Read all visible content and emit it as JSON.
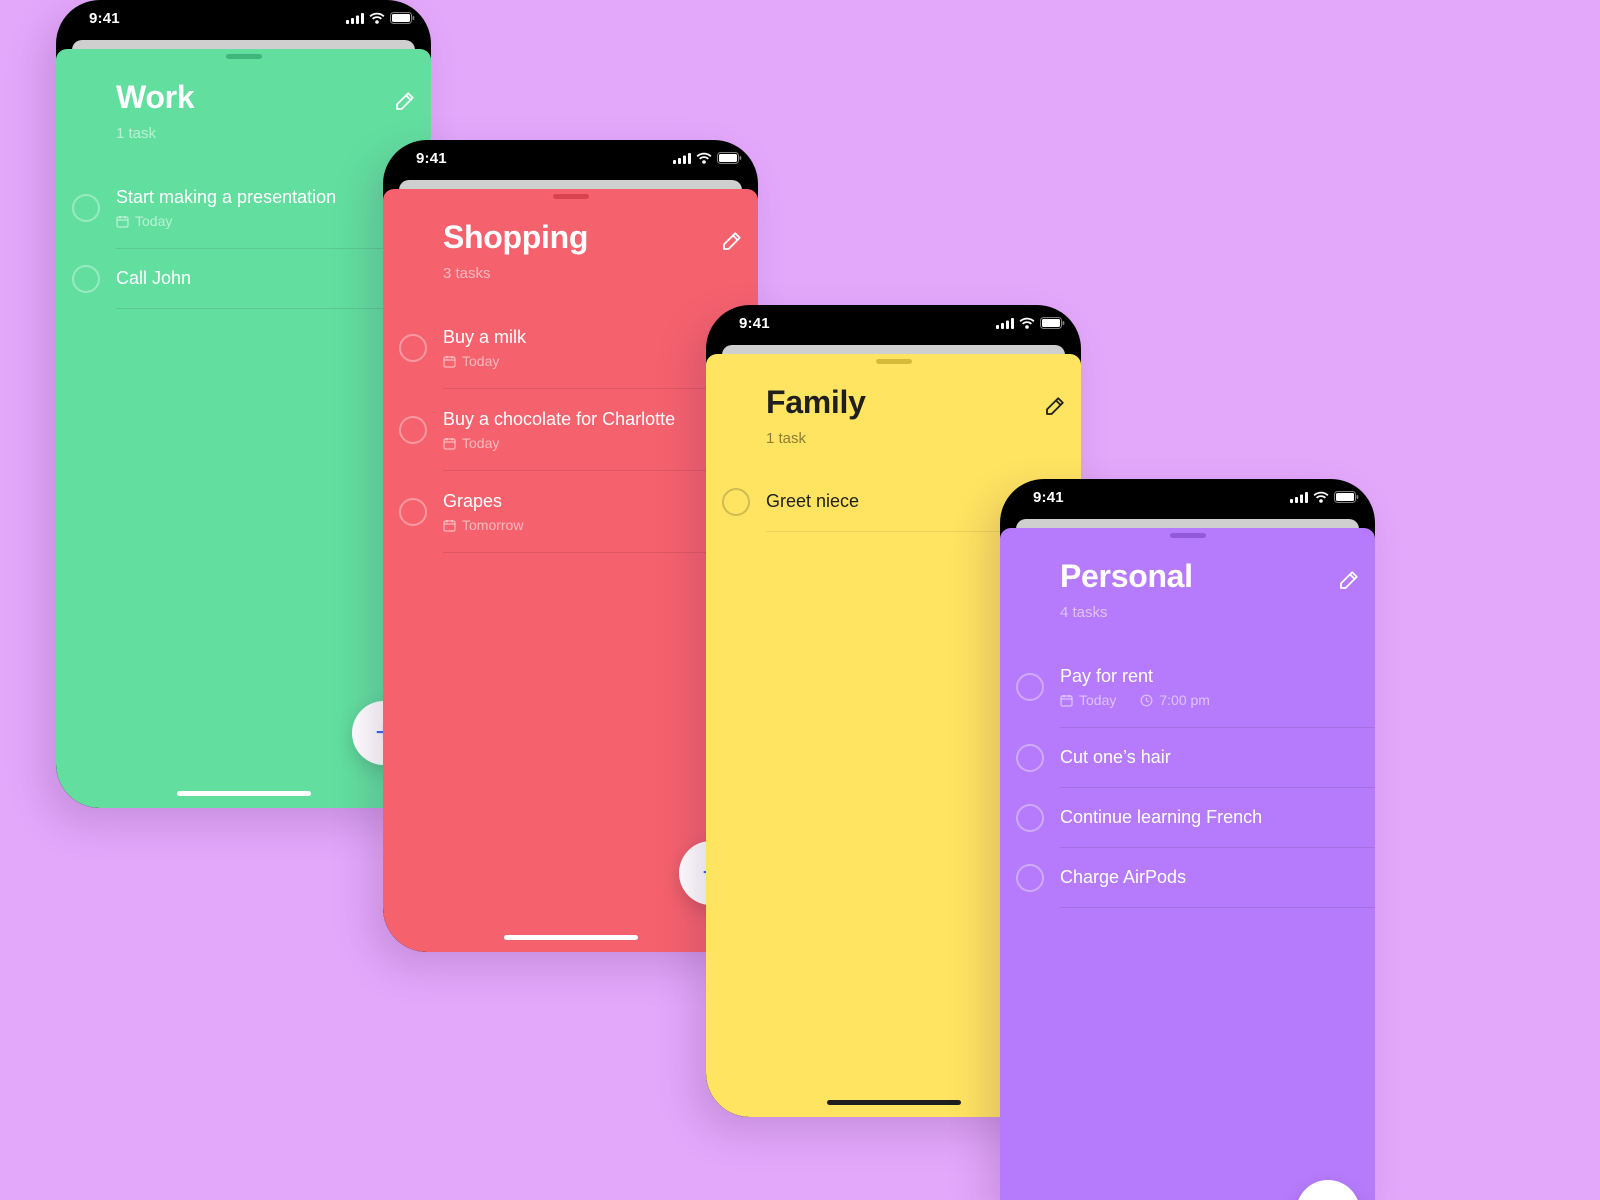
{
  "theme": {
    "background": "#e3a8fa",
    "work": "#62df9f",
    "shopping": "#f5626e",
    "family": "#fee461",
    "personal": "#b67bfd",
    "fab_plus": "#2f6bff"
  },
  "status": {
    "time": "9:41"
  },
  "icons": {
    "edit": "pencil-icon",
    "date": "calendar-icon",
    "time": "clock-icon",
    "add": "plus-icon",
    "signal": "cellular-signal-icon",
    "wifi": "wifi-icon",
    "battery": "battery-icon"
  },
  "fab": {
    "label": "+"
  },
  "lists": {
    "work": {
      "title": "Work",
      "count": "1 task",
      "tasks": [
        {
          "title": "Start making a presentation",
          "date": "Today"
        },
        {
          "title": "Call John"
        }
      ]
    },
    "shopping": {
      "title": "Shopping",
      "count": "3 tasks",
      "tasks": [
        {
          "title": "Buy a milk",
          "date": "Today"
        },
        {
          "title": "Buy a chocolate for Charlotte",
          "date": "Today"
        },
        {
          "title": "Grapes",
          "date": "Tomorrow"
        }
      ]
    },
    "family": {
      "title": "Family",
      "count": "1 task",
      "tasks": [
        {
          "title": "Greet niece"
        }
      ]
    },
    "personal": {
      "title": "Personal",
      "count": "4 tasks",
      "tasks": [
        {
          "title": "Pay for rent",
          "date": "Today",
          "time": "7:00 pm"
        },
        {
          "title": "Cut one’s hair"
        },
        {
          "title": "Continue learning French"
        },
        {
          "title": "Charge AirPods"
        }
      ]
    }
  }
}
